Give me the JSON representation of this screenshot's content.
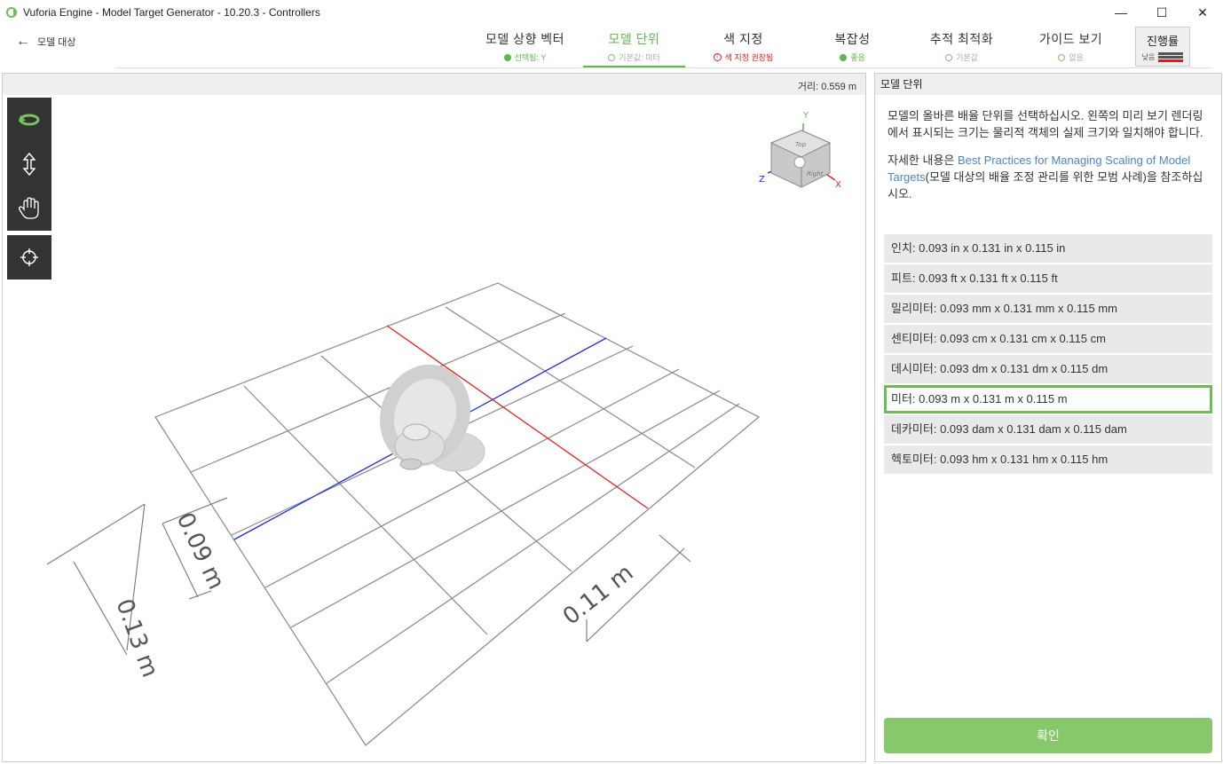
{
  "window": {
    "title": "Vuforia Engine - Model Target Generator - 10.20.3 - Controllers",
    "minimize_icon": "minimize-icon",
    "maximize_icon": "maximize-icon",
    "close_icon": "close-icon",
    "min_glyph": "—",
    "max_glyph": "☐",
    "close_glyph": "✕"
  },
  "nav": {
    "back_label": "모델 대상",
    "back_glyph": "←"
  },
  "steps": [
    {
      "label": "모델 상향 벡터",
      "status": "선택됨: Y",
      "status_color": "#5fb54f",
      "dot": "filled"
    },
    {
      "label": "모델 단위",
      "status": "기본값: 미터",
      "status_color": "#999999",
      "dot": "hollow"
    },
    {
      "label": "색 지정",
      "status": "색 지정 권장됨",
      "status_color": "#d42020",
      "dot": "warn"
    },
    {
      "label": "복잡성",
      "status": "좋음",
      "status_color": "#5fb54f",
      "dot": "filled"
    },
    {
      "label": "추적 최적화",
      "status": "기본값",
      "status_color": "#999999",
      "dot": "hollow"
    },
    {
      "label": "가이드 보기",
      "status": "없음",
      "status_color": "#999999",
      "dot": "hollow"
    }
  ],
  "progress": {
    "label": "진행률",
    "level": "낮음"
  },
  "viewport": {
    "distance": "거리: 0.559 m",
    "tools": [
      "rotate-icon",
      "pan-vertical-icon",
      "hand-icon"
    ],
    "center_tool": "crosshair-icon",
    "dimensions": [
      "0.13 m",
      "0.09 m",
      "0.11 m"
    ],
    "axes": [
      "Y",
      "Z",
      "X"
    ],
    "cube_faces": [
      "Top",
      "Right"
    ]
  },
  "panel": {
    "title": "모델 단위",
    "description": "모델의 올바른 배율 단위를 선택하십시오. 왼쪽의 미리 보기 렌더링에서 표시되는 크기는 물리적 객체의 실제 크기와 일치해야 합니다.",
    "more_prefix": "자세한 내용은 ",
    "more_link": "Best Practices for Managing Scaling of Model Targets",
    "more_suffix": "(모델 대상의 배율 조정 관리를 위한 모범 사례)을 참조하십시오.",
    "units": [
      "인치: 0.093 in x 0.131 in x 0.115 in",
      "피트: 0.093 ft x 0.131 ft x 0.115 ft",
      "밀리미터: 0.093 mm x 0.131 mm x 0.115 mm",
      "센티미터: 0.093 cm x 0.131 cm x 0.115 cm",
      "데시미터: 0.093 dm x 0.131 dm x 0.115 dm",
      "미터: 0.093 m x 0.131 m x 0.115 m",
      "데카미터: 0.093 dam x 0.131 dam x 0.115 dam",
      "헥토미터: 0.093 hm x 0.131 hm x 0.115 hm"
    ],
    "selected_unit": "미터: 0.093 m x 0.131 m x 0.115 m",
    "confirm_label": "확인"
  },
  "colors": {
    "accent": "#5fb54f",
    "warning": "#d42020",
    "button": "#87c96a",
    "link": "#4a86c8"
  }
}
